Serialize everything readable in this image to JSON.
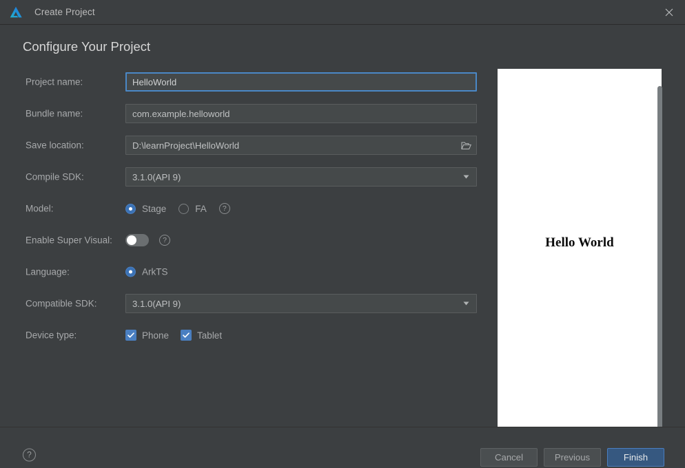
{
  "window": {
    "title": "Create Project",
    "logo_icon": "deveco-triangle-logo",
    "close_icon": "close-icon"
  },
  "page": {
    "heading": "Configure Your Project"
  },
  "form": {
    "project_name": {
      "label": "Project name:",
      "value": "HelloWorld",
      "focused": true
    },
    "bundle_name": {
      "label": "Bundle name:",
      "value": "com.example.helloworld"
    },
    "save_location": {
      "label": "Save location:",
      "value": "D:\\learnProject\\HelloWorld",
      "browse_icon": "folder-open-icon"
    },
    "compile_sdk": {
      "label": "Compile SDK:",
      "value": "3.1.0(API 9)",
      "arrow_icon": "chevron-down-icon"
    },
    "model": {
      "label": "Model:",
      "options": [
        {
          "label": "Stage",
          "selected": true
        },
        {
          "label": "FA",
          "selected": false
        }
      ],
      "help_icon": "question-mark-icon"
    },
    "super_visual": {
      "label": "Enable Super Visual:",
      "enabled": false,
      "help_icon": "question-mark-icon"
    },
    "language": {
      "label": "Language:",
      "options": [
        {
          "label": "ArkTS",
          "selected": true
        }
      ]
    },
    "compatible_sdk": {
      "label": "Compatible SDK:",
      "value": "3.1.0(API 9)",
      "arrow_icon": "chevron-down-icon"
    },
    "device_type": {
      "label": "Device type:",
      "options": [
        {
          "label": "Phone",
          "checked": true
        },
        {
          "label": "Tablet",
          "checked": true
        }
      ]
    }
  },
  "preview": {
    "text": "Hello World"
  },
  "footer": {
    "help_icon": "question-mark-icon",
    "buttons": {
      "cancel": "Cancel",
      "previous": "Previous",
      "finish": "Finish"
    }
  },
  "colors": {
    "accent": "#4a7fc1",
    "primary_button": "#365880",
    "background": "#3c3f41",
    "field_background": "#45494a"
  }
}
